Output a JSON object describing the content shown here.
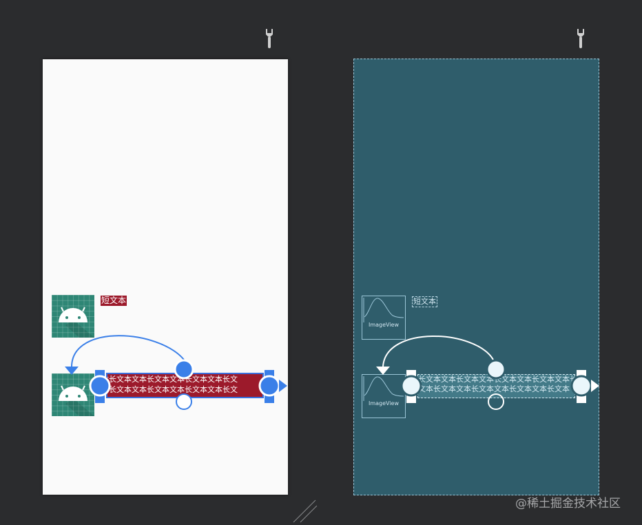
{
  "design": {
    "short_text": "短文本",
    "long_text_lines": [
      "本长文本文本长文本文本长文本文本长文",
      "本长文本文本长文本文本长文本文本长文"
    ]
  },
  "blueprint": {
    "short_text": "短文本",
    "image_view_label": "ImageView",
    "long_text_lines": [
      "长文本文本长文本文本长文本文本长文本文本长",
      "文本长文本文本长文本文本长文本文本长文本"
    ]
  },
  "watermark": "@稀土掘金技术社区",
  "colors": {
    "canvas_bg": "#2b2c2e",
    "design_bg": "#fafafa",
    "blueprint_bg": "#2f5d6b",
    "text_view_bg": "#9c1a2b",
    "image_bg": "#2e8675",
    "constraint_blue": "#3a7fe8",
    "selection_blue": "#3a6fdc"
  },
  "icons": [
    "wrench-icon",
    "android-icon",
    "imageview-placeholder-icon",
    "resize-handle-icon"
  ]
}
